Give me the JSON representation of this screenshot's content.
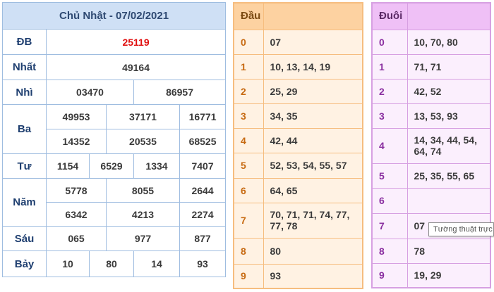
{
  "results": {
    "header": "Chủ Nhật - 07/02/2021",
    "prizes": [
      {
        "label": "ĐB",
        "values": [
          "25119"
        ]
      },
      {
        "label": "Nhất",
        "values": [
          "49164"
        ]
      },
      {
        "label": "Nhì",
        "values": [
          "03470",
          "86957"
        ]
      },
      {
        "label": "Ba",
        "values": [
          "49953",
          "37171",
          "16771",
          "14352",
          "20535",
          "68525"
        ]
      },
      {
        "label": "Tư",
        "values": [
          "1154",
          "6529",
          "1334",
          "7407"
        ]
      },
      {
        "label": "Năm",
        "values": [
          "5778",
          "8055",
          "2644",
          "6342",
          "4213",
          "2274"
        ]
      },
      {
        "label": "Sáu",
        "values": [
          "065",
          "977",
          "877"
        ]
      },
      {
        "label": "Bảy",
        "values": [
          "10",
          "80",
          "14",
          "93"
        ]
      }
    ]
  },
  "dau": {
    "header": "Đầu",
    "rows": [
      {
        "key": "0",
        "value": "07"
      },
      {
        "key": "1",
        "value": "10, 13, 14, 19"
      },
      {
        "key": "2",
        "value": "25, 29"
      },
      {
        "key": "3",
        "value": "34, 35"
      },
      {
        "key": "4",
        "value": "42, 44"
      },
      {
        "key": "5",
        "value": "52, 53, 54, 55, 57"
      },
      {
        "key": "6",
        "value": "64, 65"
      },
      {
        "key": "7",
        "value": "70, 71, 71, 74, 77, 77, 78"
      },
      {
        "key": "8",
        "value": "80"
      },
      {
        "key": "9",
        "value": "93"
      }
    ]
  },
  "duoi": {
    "header": "Đuôi",
    "rows": [
      {
        "key": "0",
        "value": "10, 70, 80"
      },
      {
        "key": "1",
        "value": "71, 71"
      },
      {
        "key": "2",
        "value": "42, 52"
      },
      {
        "key": "3",
        "value": "13, 53, 93"
      },
      {
        "key": "4",
        "value": "14, 34, 44, 54, 64, 74"
      },
      {
        "key": "5",
        "value": "25, 35, 55, 65"
      },
      {
        "key": "6",
        "value": ""
      },
      {
        "key": "7",
        "value": "07"
      },
      {
        "key": "8",
        "value": "78"
      },
      {
        "key": "9",
        "value": "19, 29"
      }
    ]
  },
  "tooltip": {
    "text": "Tường thuật trực"
  },
  "colors": {
    "special_prize": "#e01010",
    "results_border": "#8fb3de",
    "dau_border": "#f6bd7f",
    "duoi_border": "#d7a0e2"
  }
}
